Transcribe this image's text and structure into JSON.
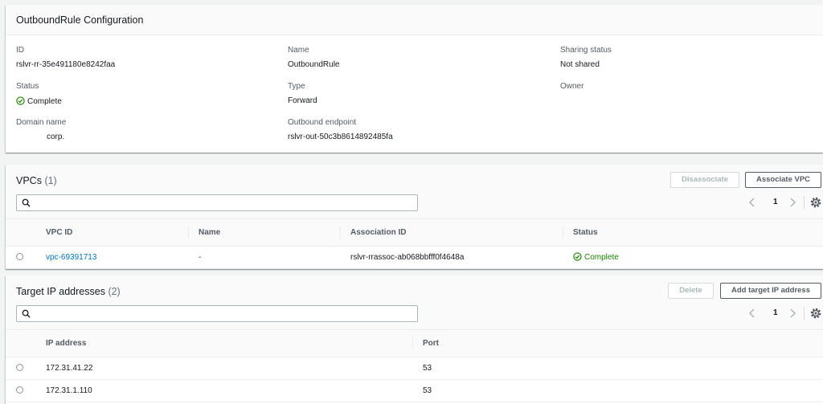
{
  "config": {
    "title": "OutboundRule Configuration",
    "fields": {
      "id_label": "ID",
      "id_value": "rslvr-rr-35e491180e8242faa",
      "name_label": "Name",
      "name_value": "OutboundRule",
      "sharing_label": "Sharing status",
      "sharing_value": "Not shared",
      "status_label": "Status",
      "status_value": "Complete",
      "type_label": "Type",
      "type_value": "Forward",
      "owner_label": "Owner",
      "domain_label": "Domain name",
      "domain_value": "corp.",
      "endpoint_label": "Outbound endpoint",
      "endpoint_value": "rslvr-out-50c3b8614892485fa"
    }
  },
  "vpcs": {
    "title": "VPCs",
    "count": "(1)",
    "disassociate_label": "Disassociate",
    "associate_label": "Associate VPC",
    "search_placeholder": "",
    "page": "1",
    "columns": [
      "VPC ID",
      "Name",
      "Association ID",
      "Status"
    ],
    "rows": [
      {
        "vpc_id": "vpc-69391713",
        "name": "-",
        "association_id": "rslvr-rrassoc-ab068bbfff0f4648a",
        "status": "Complete"
      }
    ]
  },
  "targets": {
    "title": "Target IP addresses",
    "count": "(2)",
    "delete_label": "Delete",
    "add_label": "Add target IP address",
    "search_placeholder": "",
    "page": "1",
    "columns": [
      "IP address",
      "Port"
    ],
    "rows": [
      {
        "ip": "172.31.41.22",
        "port": "53"
      },
      {
        "ip": "172.31.1.110",
        "port": "53"
      }
    ]
  },
  "colors": {
    "status_ok": "#1d8102",
    "link": "#0073bb",
    "background": "#f2f3f3"
  },
  "icons": [
    "check-circle-icon",
    "search-icon",
    "chevron-left-icon",
    "chevron-right-icon",
    "gear-icon"
  ]
}
